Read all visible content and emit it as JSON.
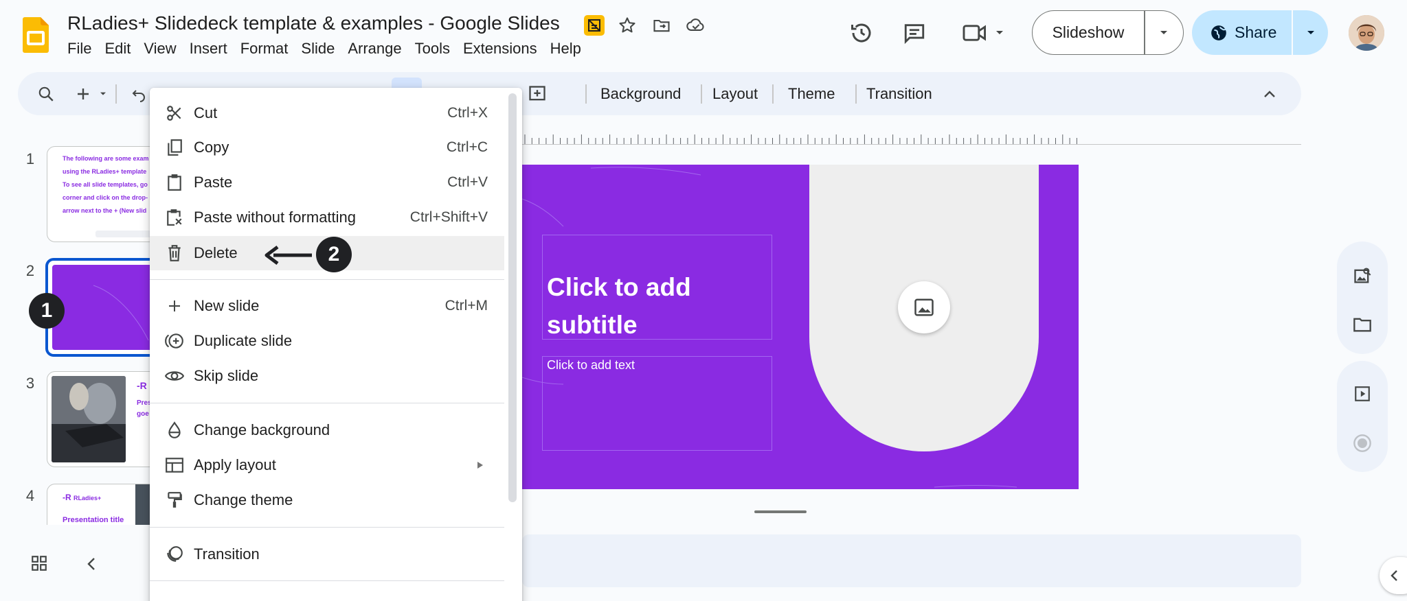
{
  "window": {
    "doc_title": "RLadies+ Slidedeck template & examples - Google Slides"
  },
  "menubar": [
    "File",
    "Edit",
    "View",
    "Insert",
    "Format",
    "Slide",
    "Arrange",
    "Tools",
    "Extensions",
    "Help"
  ],
  "header": {
    "slideshow_label": "Slideshow",
    "share_label": "Share"
  },
  "toolbar": {
    "background_label": "Background",
    "layout_label": "Layout",
    "theme_label": "Theme",
    "transition_label": "Transition"
  },
  "filmstrip": {
    "slides": [
      {
        "number": "1",
        "lines": [
          "The following are some exam",
          "using the RLadies+ template",
          "To see all slide templates, go",
          "corner and click on the drop-",
          "arrow next to the + (New slid"
        ]
      },
      {
        "number": "2"
      },
      {
        "number": "3",
        "text": "Pres goe"
      },
      {
        "number": "4",
        "brand": "RLadies+",
        "title": "Presentation title"
      }
    ]
  },
  "slide": {
    "subtitle_placeholder": "Click to add subtitle",
    "text_placeholder": "Click to add text",
    "accent_color": "#8a2be2"
  },
  "context_menu": {
    "groups": [
      [
        {
          "label": "Cut",
          "shortcut": "Ctrl+X",
          "icon": "scissors-icon"
        },
        {
          "label": "Copy",
          "shortcut": "Ctrl+C",
          "icon": "copy-icon"
        },
        {
          "label": "Paste",
          "shortcut": "Ctrl+V",
          "icon": "clipboard-icon"
        },
        {
          "label": "Paste without formatting",
          "shortcut": "Ctrl+Shift+V",
          "icon": "clipboard-plain-icon"
        },
        {
          "label": "Delete",
          "shortcut": "",
          "icon": "trash-icon"
        }
      ],
      [
        {
          "label": "New slide",
          "shortcut": "Ctrl+M",
          "icon": "plus-icon"
        },
        {
          "label": "Duplicate slide",
          "shortcut": "",
          "icon": "duplicate-icon"
        },
        {
          "label": "Skip slide",
          "shortcut": "",
          "icon": "eye-icon"
        }
      ],
      [
        {
          "label": "Change background",
          "shortcut": "",
          "icon": "fill-drop-icon"
        },
        {
          "label": "Apply layout",
          "shortcut": "",
          "icon": "layout-icon"
        },
        {
          "label": "Change theme",
          "shortcut": "",
          "icon": "paint-roller-icon"
        }
      ],
      [
        {
          "label": "Transition",
          "shortcut": "",
          "icon": "transition-icon"
        }
      ]
    ]
  },
  "annotations": {
    "marker_1": "1",
    "marker_2": "2"
  }
}
